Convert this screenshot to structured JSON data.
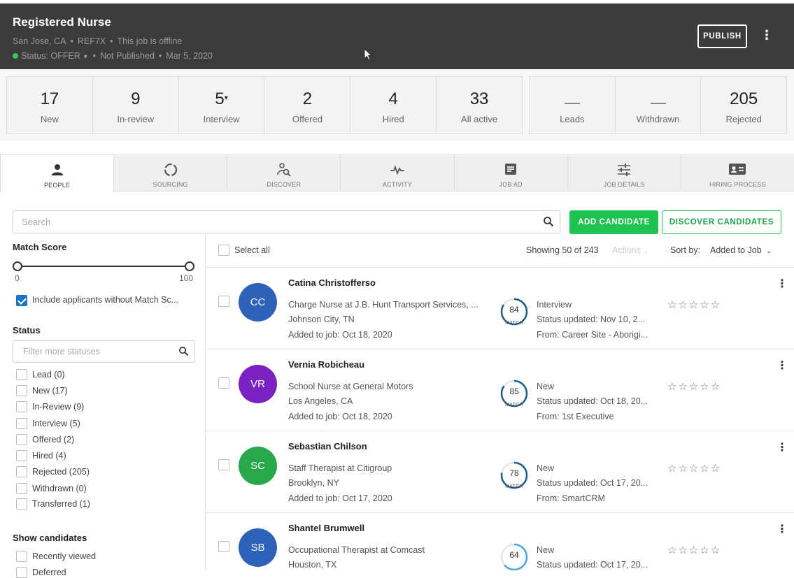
{
  "job": {
    "title": "Registered Nurse",
    "location": "San Jose, CA",
    "ref": "REF7X",
    "online_state": "This job is offline",
    "status_label": "Status:",
    "status_value": "OFFER",
    "publish_state": "Not Published",
    "date": "Mar 5, 2020",
    "publish_label": "PUBLISH"
  },
  "stats": [
    {
      "num": "17",
      "label": "New"
    },
    {
      "num": "9",
      "label": "In-review"
    },
    {
      "num": "5",
      "label": "Interview"
    },
    {
      "num": "2",
      "label": "Offered"
    },
    {
      "num": "4",
      "label": "Hired"
    },
    {
      "num": "33",
      "label": "All active"
    }
  ],
  "stats2": [
    {
      "num": "",
      "label": "Leads"
    },
    {
      "num": "",
      "label": "Withdrawn"
    },
    {
      "num": "205",
      "label": "Rejected"
    }
  ],
  "tabs": [
    {
      "label": "PEOPLE",
      "icon": "person-icon"
    },
    {
      "label": "SOURCING",
      "icon": "sourcing-icon"
    },
    {
      "label": "DISCOVER",
      "icon": "discover-icon"
    },
    {
      "label": "ACTIVITY",
      "icon": "activity-icon"
    },
    {
      "label": "JOB AD",
      "icon": "job-ad-icon"
    },
    {
      "label": "JOB DETAILS",
      "icon": "sliders-icon"
    },
    {
      "label": "HIRING PROCESS",
      "icon": "id-card-icon"
    }
  ],
  "search": {
    "placeholder": "Search"
  },
  "buttons": {
    "add": "ADD CANDIDATE",
    "discover": "DISCOVER CANDIDATES"
  },
  "filters": {
    "match_title": "Match Score",
    "min": "0",
    "max": "100",
    "include_label": "Include applicants without Match Sc...",
    "status_title": "Status",
    "status_placeholder": "Filter more statuses",
    "statuses": [
      "Lead (0)",
      "New (17)",
      "In-Review (9)",
      "Interview (5)",
      "Offered (2)",
      "Hired (4)",
      "Rejected (205)",
      "Withdrawn (0)",
      "Transferred (1)"
    ],
    "show_title": "Show candidates",
    "show_items": [
      "Recently viewed",
      "Deferred"
    ]
  },
  "list": {
    "select_all": "Select all",
    "showing": "Showing 50 of 243",
    "actions": "Actions",
    "sort_label": "Sort by:",
    "sort_value": "Added to Job"
  },
  "candidates": [
    {
      "initials": "CC",
      "color": "#2d62b8",
      "name": "Catina Christofferso",
      "role": "Charge Nurse at J.B. Hunt Transport Services, ...",
      "location": "Johnson City, TN",
      "added": "Added to job: Oct 18, 2020",
      "match": 84,
      "match_label": "MATCH",
      "status": "Interview",
      "updated": "Status updated: Nov 10, 2...",
      "source": "From: Career Site - Aborigi..."
    },
    {
      "initials": "VR",
      "color": "#7b22c3",
      "name": "Vernia Robicheau",
      "role": "School Nurse at General Motors",
      "location": "Los Angeles, CA",
      "added": "Added to job: Oct 18, 2020",
      "match": 85,
      "match_label": "MATCH",
      "status": "New",
      "updated": "Status updated: Oct 18, 20...",
      "source": "From: 1st Executive"
    },
    {
      "initials": "SC",
      "color": "#27a84a",
      "name": "Sebastian Chilson",
      "role": "Staff Therapist at Citigroup",
      "location": "Brooklyn, NY",
      "added": "Added to job: Oct 17, 2020",
      "match": 78,
      "match_label": "MATCH",
      "status": "New",
      "updated": "Status updated: Oct 17, 20...",
      "source": "From: SmartCRM"
    },
    {
      "initials": "SB",
      "color": "#2d62b8",
      "name": "Shantel Brumwell",
      "role": "Occupational Therapist at Comcast",
      "location": "Houston, TX",
      "added": "",
      "match": 64,
      "match_label": "",
      "status": "New",
      "updated": "Status updated: Oct 17, 20...",
      "source": ""
    }
  ]
}
